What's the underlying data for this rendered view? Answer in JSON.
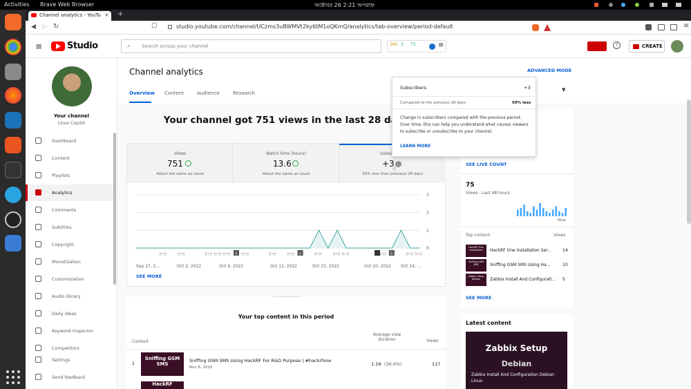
{
  "os": {
    "activities": "Activities",
    "app_name": "Brave Web Browser",
    "clock": "অক্টোবর 26  2:21 অপরাহ্ন"
  },
  "browser": {
    "tab_title": "Channel analytics - YouTu",
    "new_tab": "+",
    "url": "studio.youtube.com/channel/UCzms3uBWMVt2ky6tM1oQKmQ/analytics/tab-overview/period-default"
  },
  "studio": {
    "logo_text": "Studio",
    "search_placeholder": "Search across your channel",
    "mini_stats": [
      "362",
      "3",
      "75"
    ],
    "create_label": "CREATE"
  },
  "sidebar": {
    "channel_title": "Your channel",
    "channel_name": "Linux Copilot",
    "items": [
      {
        "label": "Dashboard",
        "icon": "dashboard-icon"
      },
      {
        "label": "Content",
        "icon": "content-icon"
      },
      {
        "label": "Playlists",
        "icon": "playlists-icon"
      },
      {
        "label": "Analytics",
        "icon": "analytics-icon"
      },
      {
        "label": "Comments",
        "icon": "comments-icon"
      },
      {
        "label": "Subtitles",
        "icon": "subtitles-icon"
      },
      {
        "label": "Copyright",
        "icon": "copyright-icon"
      },
      {
        "label": "Monetization",
        "icon": "monetization-icon"
      },
      {
        "label": "Customization",
        "icon": "customization-icon"
      },
      {
        "label": "Audio library",
        "icon": "audio-library-icon"
      },
      {
        "label": "Daily ideas",
        "icon": "daily-ideas-icon"
      },
      {
        "label": "Keyword Inspector",
        "icon": "keyword-inspector-icon"
      },
      {
        "label": "Competitors",
        "icon": "competitors-icon"
      },
      {
        "label": "Settings",
        "icon": "settings-icon"
      },
      {
        "label": "Send feedback",
        "icon": "feedback-icon"
      }
    ]
  },
  "page": {
    "title": "Channel analytics",
    "advanced_mode": "ADVANCED MODE",
    "tabs": [
      "Overview",
      "Content",
      "Audience",
      "Research"
    ],
    "headline": "Your channel got 751 views in the last 28 days",
    "metrics": [
      {
        "label": "Views",
        "value": "751",
        "note": "About the same as usual"
      },
      {
        "label": "Watch time (hours)",
        "value": "13.6",
        "note": "About the same as usual"
      },
      {
        "label": "Subsc",
        "value": "+3",
        "note": "50% less than previous 28 days"
      }
    ],
    "see_more": "SEE MORE",
    "top_content_title": "Your top content in this period",
    "table_headers": {
      "content": "Content",
      "avg": "Average view duration",
      "views": "Views"
    },
    "rows": [
      {
        "rank": "1",
        "thumb": "Sniffing GSM SMS",
        "title": "Sniffing GSM SMS Using HackRF For R&D Purpose | #hackrfone",
        "date": "Nov 8, 2020",
        "duration": "1:16",
        "pct": "(36.6%)",
        "views": "117"
      },
      {
        "thumb": "HackRF"
      }
    ]
  },
  "chart_data": {
    "type": "line",
    "x_tick_labels": [
      "Sep 27, 2...",
      "Oct 2, 2022",
      "Oct 6, 2022",
      "Oct 11, 2022",
      "Oct 15, 2022",
      "Oct 20, 2022",
      "Oct 24, ..."
    ],
    "y_tick_labels": [
      "3",
      "2",
      "1",
      "0"
    ],
    "ylim": [
      0,
      3
    ],
    "series": [
      {
        "values": [
          0,
          0,
          0,
          0,
          0,
          0,
          0,
          0,
          0,
          0,
          0,
          0,
          0,
          0,
          0,
          0,
          0,
          0,
          0,
          0,
          1,
          0,
          1,
          0,
          0,
          0,
          0,
          0,
          0,
          1,
          0,
          0
        ]
      }
    ],
    "markers": [
      "2",
      "2",
      "5"
    ]
  },
  "tooltip": {
    "title": "Subscribers",
    "value": "+3",
    "compare_label": "Compared to the previous 28 days",
    "compare_value": "50% less",
    "description": "Change in subscribers compared with the previous period. Over time, this can help you understand what causes viewers to subscribe or unsubscribe to your channel.",
    "learn_more": "LEARN MORE"
  },
  "realtime": {
    "see_live": "SEE LIVE COUNT",
    "views_value": "75",
    "views_label": "Views · Last 48 hours",
    "now_label": "Now",
    "bars": [
      0.2,
      0.1,
      0.3,
      0.2,
      0.5,
      0.3,
      0.6,
      0.2,
      1.0,
      0.4,
      0.7,
      0.5,
      0.8,
      0.3,
      0.6,
      0.9,
      0.4,
      0.5,
      0.7,
      0.3,
      0.2,
      0.6,
      0.4,
      0.8,
      0.5,
      0.3,
      0.2,
      0.4,
      0.6,
      0.3,
      0.2,
      0.5
    ],
    "top_content_label": "Top content",
    "views_col": "Views",
    "items": [
      {
        "thumb": "HackRF One Installation",
        "title": "HackRF One Installation Ser...",
        "views": "14"
      },
      {
        "thumb": "Sniffing GSM SMS",
        "title": "Sniffing GSM SMS Using Ha...",
        "views": "10"
      },
      {
        "thumb": "Zabbix Setup Debian",
        "title": "Zabbix Install And Configurati...",
        "views": "5"
      }
    ],
    "see_more": "SEE MORE"
  },
  "latest": {
    "title": "Latest content",
    "thumb_line1": "Zabbix Setup",
    "thumb_line2": "Debian",
    "caption": "Zabbix Install And Configuration Debian Linux"
  }
}
